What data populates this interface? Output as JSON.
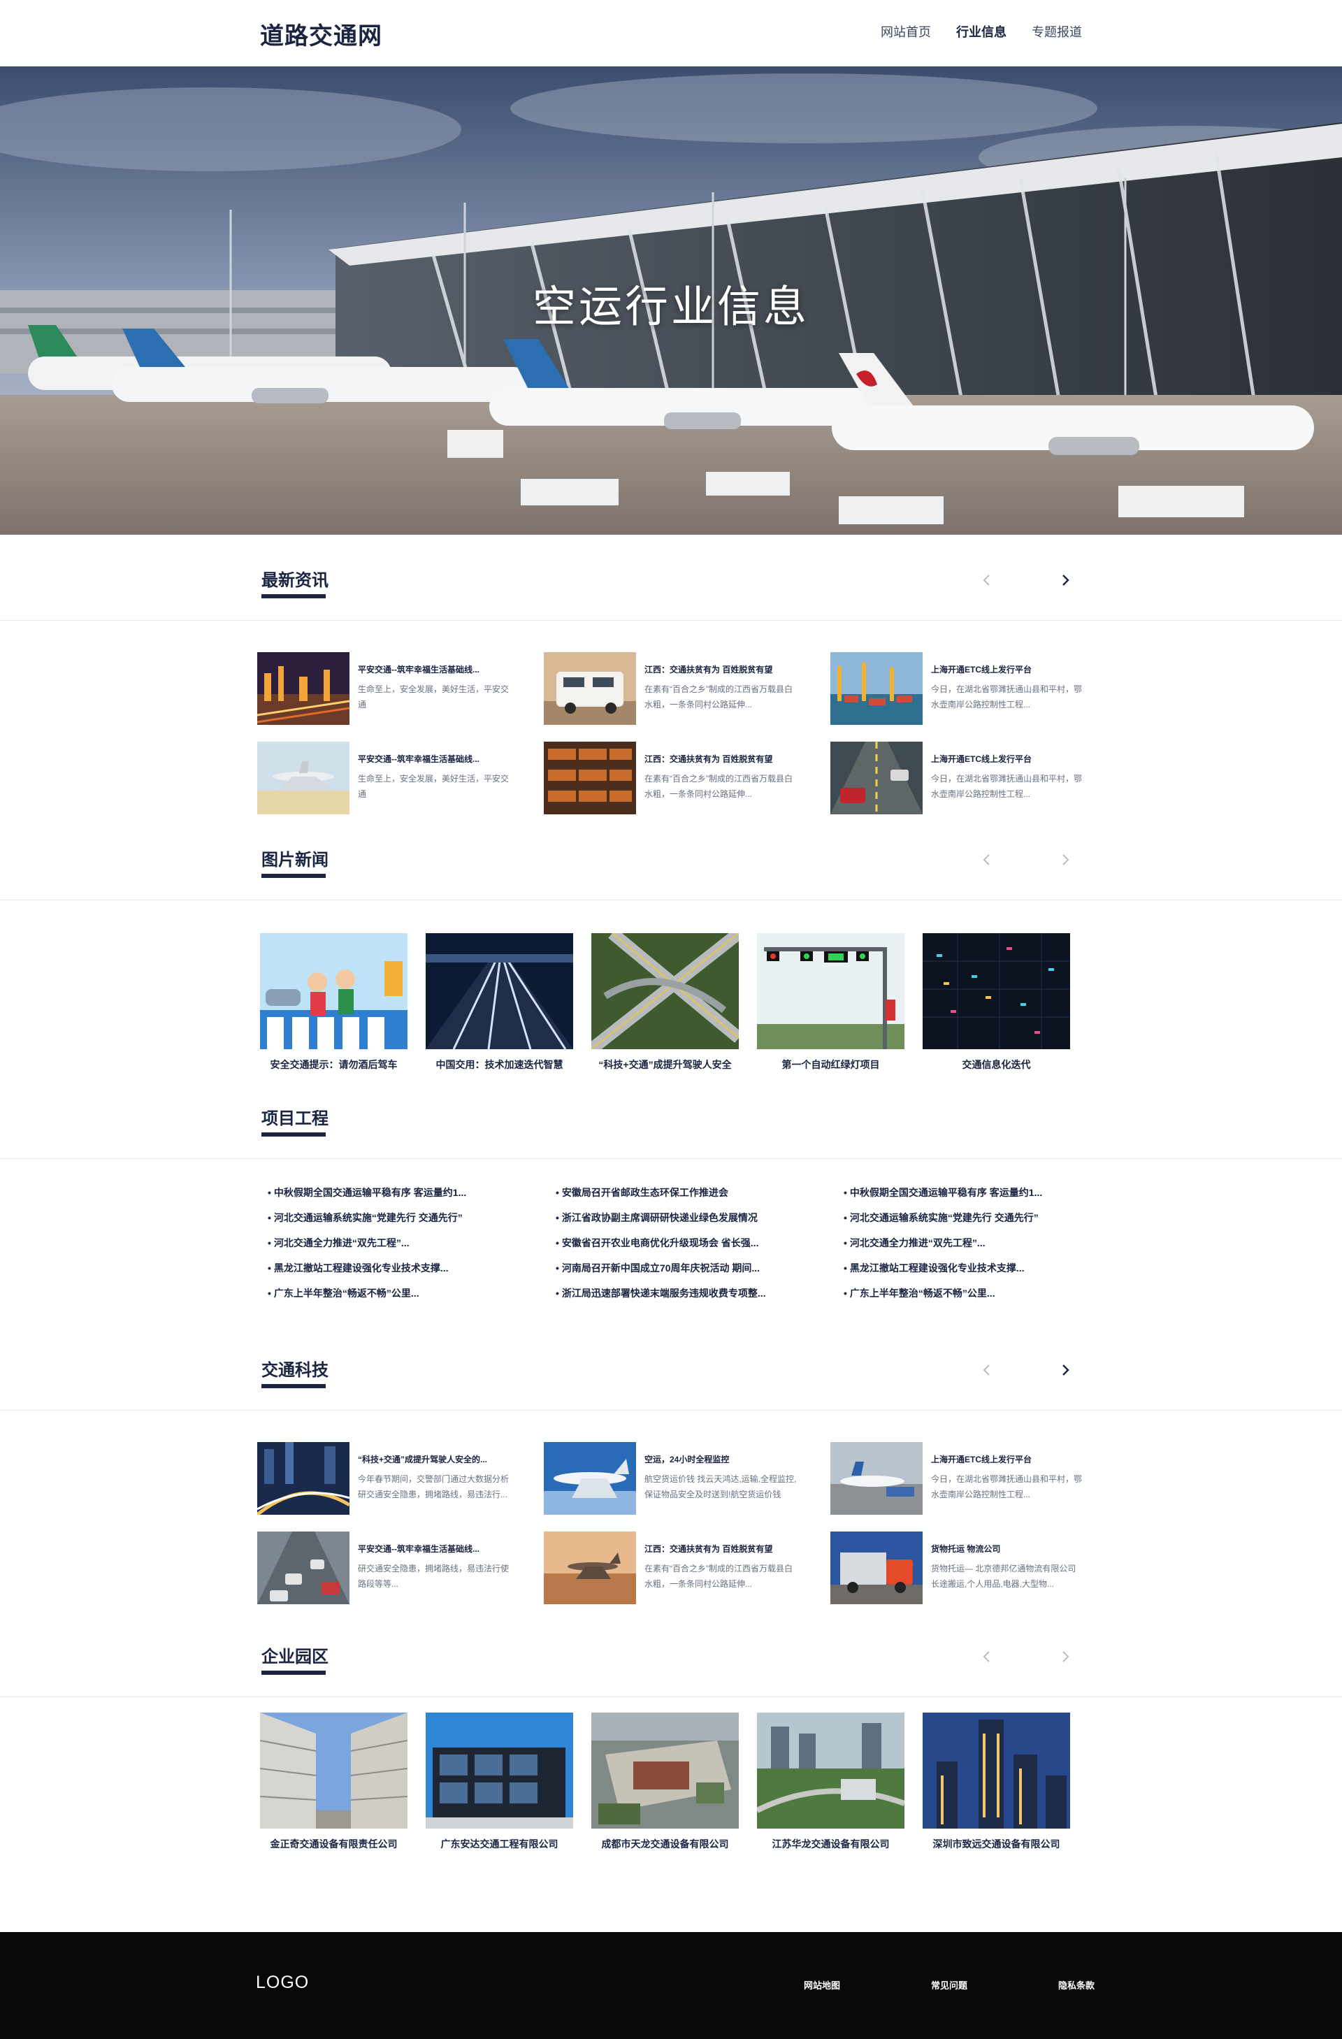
{
  "header": {
    "site_title": "道路交通网",
    "nav": [
      {
        "label": "网站首页"
      },
      {
        "label": "行业信息"
      },
      {
        "label": "专题报道"
      }
    ],
    "active_nav": "行业信息"
  },
  "hero": {
    "title": "空运行业信息"
  },
  "latest_news": {
    "title": "最新资讯",
    "items": [
      {
        "title": "平安交通--筑牢幸福生活基础线...",
        "desc": "生命至上，安全发展，美好生活，平安交通"
      },
      {
        "title": "江西：交通扶贫有为 百姓脱贫有望",
        "desc": "在素有“百合之乡”制成的江西省万载县白水粗，一条条同村公路延伸..."
      },
      {
        "title": "上海开通ETC线上发行平台",
        "desc": "今日，在湖北省鄂濉抚通山县和平村，鄂水壶南岸公路控制性工程..."
      },
      {
        "title": "平安交通--筑牢幸福生活基础线...",
        "desc": "生命至上，安全发展，美好生活，平安交通"
      },
      {
        "title": "江西：交通扶贫有为 百姓脱贫有望",
        "desc": "在素有“百合之乡”制成的江西省万载县白水粗，一条条同村公路延伸..."
      },
      {
        "title": "上海开通ETC线上发行平台",
        "desc": "今日，在湖北省鄂濉抚通山县和平村，鄂水壶南岸公路控制性工程..."
      }
    ]
  },
  "picture_news": {
    "title": "图片新闻",
    "items": [
      {
        "caption": "安全交通提示：请勿酒后驾车"
      },
      {
        "caption": "中国交用：技术加速迭代智慧"
      },
      {
        "caption": "“科技+交通”成提升驾驶人安全"
      },
      {
        "caption": "第一个自动红绿灯项目"
      },
      {
        "caption": "交通信息化迭代"
      }
    ]
  },
  "projects": {
    "title": "项目工程",
    "columns": [
      [
        "中秋假期全国交通运输平稳有序 客运量约1...",
        "河北交通运输系统实施“党建先行 交通先行”",
        "河北交通全力推进“双先工程”...",
        "黑龙江撤站工程建设强化专业技术支撑...",
        "广东上半年整治“畅返不畅”公里..."
      ],
      [
        "安徽局召开省邮政生态环保工作推进会",
        "浙江省政协副主席调研研快递业绿色发展情况",
        "安徽省召开农业电商优化升级现场会 省长强...",
        "河南局召开新中国成立70周年庆祝活动 期间...",
        "浙江局迅速部署快递末端服务违规收费专项整..."
      ],
      [
        "中秋假期全国交通运输平稳有序 客运量约1...",
        "河北交通运输系统实施“党建先行 交通先行”",
        "河北交通全力推进“双先工程”...",
        "黑龙江撤站工程建设强化专业技术支撑...",
        "广东上半年整治“畅返不畅”公里..."
      ]
    ]
  },
  "tech": {
    "title": "交通科技",
    "items": [
      {
        "title": "“科技+交通”成提升驾驶人安全的...",
        "desc": "今年春节期间，交警部门通过大数据分析研交通安全隐患，拥堵路线，易违法行..."
      },
      {
        "title": "空运，24小时全程监控",
        "desc": "航空货运价钱 找云天鸿达,运输,全程监控,保证物品安全及时送到!航空货运价钱"
      },
      {
        "title": "上海开通ETC线上发行平台",
        "desc": "今日，在湖北省鄂濉抚通山县和平村，鄂水壶南岸公路控制性工程..."
      },
      {
        "title": "平安交通--筑牢幸福生活基础线...",
        "desc": "研交通安全隐患，拥堵路线，易违法行使路段等等..."
      },
      {
        "title": "江西：交通扶贫有为 百姓脱贫有望",
        "desc": "在素有“百合之乡”制成的江西省万载县白水粗，一条条同村公路延伸..."
      },
      {
        "title": "货物托运 物流公司",
        "desc": "货物托运— 北京德邦亿通物流有限公司 长途搬运,个人用品,电器,大型物..."
      }
    ]
  },
  "enterprise": {
    "title": "企业园区",
    "items": [
      {
        "caption": "金正奇交通设备有限责任公司"
      },
      {
        "caption": "广东安达交通工程有限公司"
      },
      {
        "caption": "成都市天龙交通设备有限公司"
      },
      {
        "caption": "江苏华龙交通设备有限公司"
      },
      {
        "caption": "深圳市致远交通设备有限公司"
      }
    ]
  },
  "footer": {
    "logo": "LOGO",
    "links": [
      {
        "label": "网站地图"
      },
      {
        "label": "常见问题"
      },
      {
        "label": "隐私条款"
      }
    ]
  },
  "colors": {
    "brand_navy": "#1b2440",
    "footer_bg": "#070808",
    "arrow_inactive": "#b9bcc6"
  }
}
